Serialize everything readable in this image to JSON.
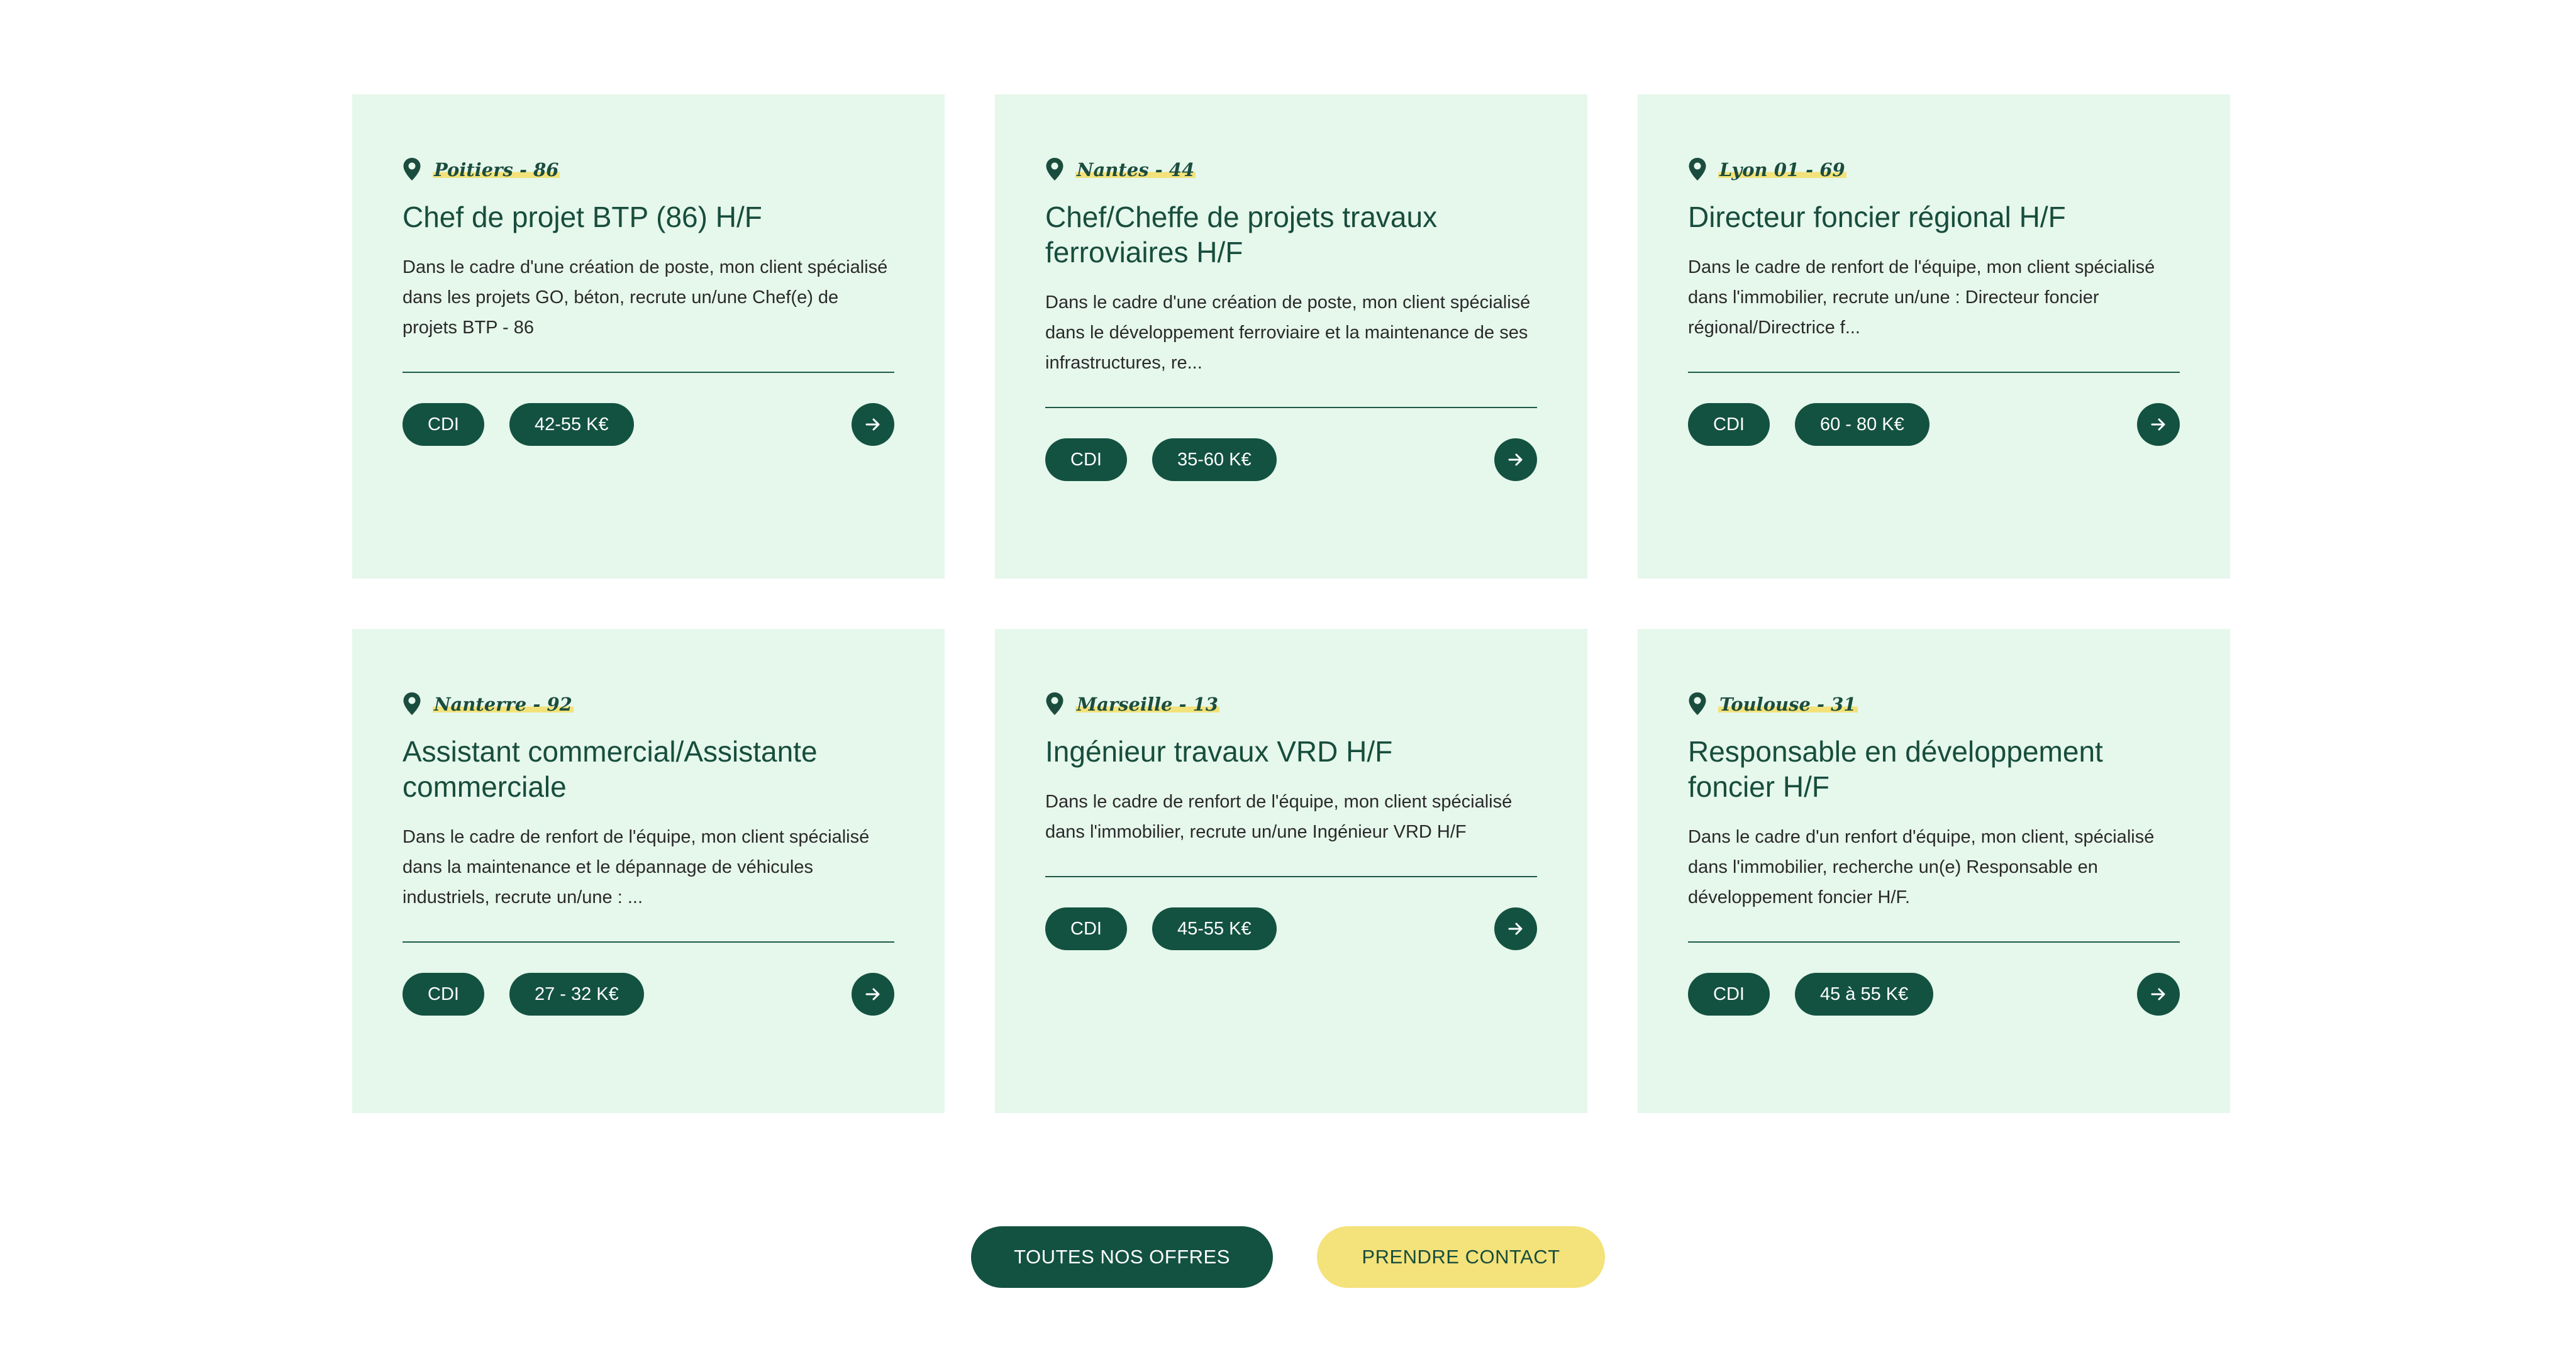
{
  "colors": {
    "card_background": "#e6f7ec",
    "brand_green": "#135240",
    "accent_yellow": "#f4e27a"
  },
  "jobs": [
    {
      "location": "Poitiers - 86",
      "title": "Chef de projet BTP (86) H/F",
      "description": "Dans le cadre d'une création de poste, mon client spécialisé dans les projets GO, béton, recrute un/une Chef(e) de projets BTP - 86",
      "contract": "CDI",
      "salary": "42-55 K€"
    },
    {
      "location": "Nantes - 44",
      "title": "Chef/Cheffe de projets travaux ferroviaires H/F",
      "description": "Dans le cadre d'une création de poste, mon client spécialisé dans le développement ferroviaire et la maintenance de ses infrastructures, re...",
      "contract": "CDI",
      "salary": "35-60 K€"
    },
    {
      "location": "Lyon 01 - 69",
      "title": "Directeur foncier régional H/F",
      "description": "Dans le cadre de renfort de l'équipe, mon client spécialisé dans l'immobilier, recrute un/une : Directeur foncier régional/Directrice f...",
      "contract": "CDI",
      "salary": "60 - 80 K€"
    },
    {
      "location": "Nanterre - 92",
      "title": "Assistant commercial/Assistante commerciale",
      "description": "Dans le cadre de renfort de l'équipe, mon client spécialisé dans la maintenance et le dépannage de véhicules industriels, recrute un/une : ...",
      "contract": "CDI",
      "salary": "27 - 32 K€"
    },
    {
      "location": "Marseille - 13",
      "title": "Ingénieur travaux VRD H/F",
      "description": "Dans le cadre de renfort de l'équipe, mon client spécialisé dans l'immobilier, recrute un/une Ingénieur VRD H/F",
      "contract": "CDI",
      "salary": "45-55 K€"
    },
    {
      "location": "Toulouse - 31",
      "title": "Responsable en développement foncier H/F",
      "description": "Dans le cadre d'un renfort d'équipe, mon client, spécialisé dans l'immobilier, recherche un(e) Responsable en développement foncier H/F.",
      "contract": "CDI",
      "salary": "45 à 55 K€"
    }
  ],
  "icons": {
    "location": "map-pin-icon",
    "open": "arrow-right-icon"
  },
  "actions": {
    "all_offers_label": "TOUTES NOS OFFRES",
    "contact_label": "PRENDRE CONTACT"
  }
}
